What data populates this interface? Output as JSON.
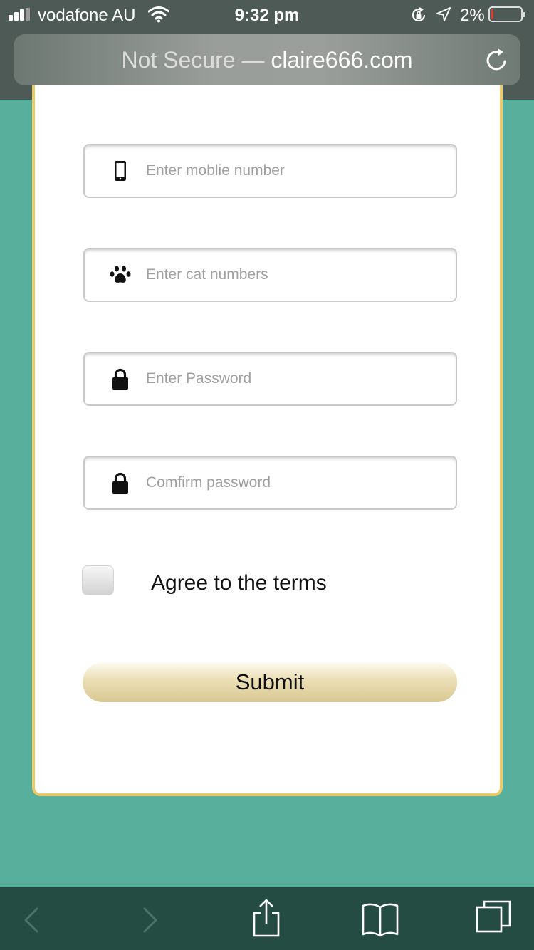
{
  "status_bar": {
    "carrier": "vodafone AU",
    "time": "9:32 pm",
    "battery_percent": "2%",
    "signal_bars": 3,
    "icons": [
      "signal-icon",
      "wifi-icon",
      "rotation-lock-icon",
      "location-arrow-icon",
      "battery-icon"
    ]
  },
  "browser": {
    "security_label": "Not Secure",
    "separator": " — ",
    "domain": "claire666.com",
    "reload_icon": "reload-icon"
  },
  "form": {
    "fields": [
      {
        "icon": "mobile-phone-icon",
        "placeholder": "Enter moblie number",
        "value": ""
      },
      {
        "icon": "paw-icon",
        "placeholder": "Enter cat numbers",
        "value": ""
      },
      {
        "icon": "lock-icon",
        "placeholder": "Enter Password",
        "value": ""
      },
      {
        "icon": "lock-icon",
        "placeholder": "Comfirm password",
        "value": ""
      }
    ],
    "agree_label": "Agree to the terms",
    "agree_checked": false,
    "submit_label": "Submit"
  },
  "toolbar": {
    "icons": [
      "back-arrow-icon",
      "forward-arrow-icon",
      "share-icon",
      "bookmarks-icon",
      "tabs-icon"
    ]
  },
  "colors": {
    "page_background": "#58b09c",
    "card_border": "#ecca68",
    "toolbar_background": "#244c42",
    "submit_gradient_end": "#d9c893"
  }
}
